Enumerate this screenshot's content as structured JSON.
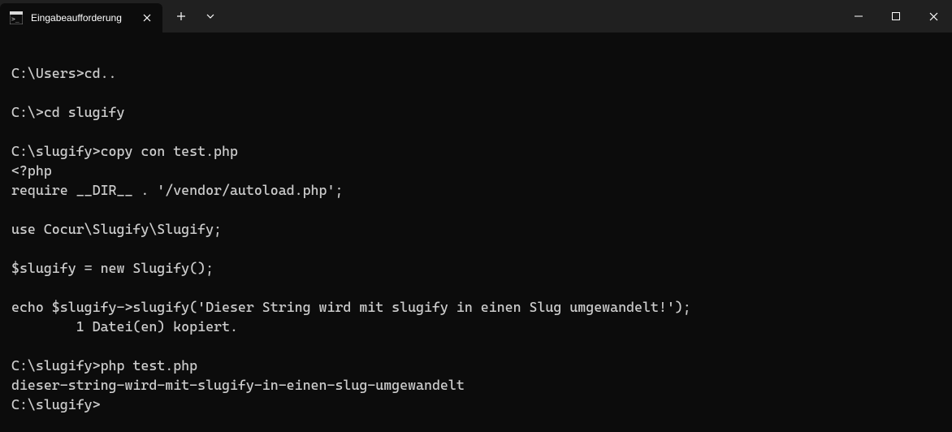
{
  "tab": {
    "title": "Eingabeaufforderung"
  },
  "terminal": {
    "lines": [
      "",
      "C:\\Users>cd..",
      "",
      "C:\\>cd slugify",
      "",
      "C:\\slugify>copy con test.php",
      "<?php",
      "require __DIR__ . '/vendor/autoload.php';",
      "",
      "use Cocur\\Slugify\\Slugify;",
      "",
      "$slugify = new Slugify();",
      "",
      "echo $slugify->slugify('Dieser String wird mit slugify in einen Slug umgewandelt!');",
      "        1 Datei(en) kopiert.",
      "",
      "C:\\slugify>php test.php",
      "dieser-string-wird-mit-slugify-in-einen-slug-umgewandelt",
      "C:\\slugify>"
    ]
  }
}
